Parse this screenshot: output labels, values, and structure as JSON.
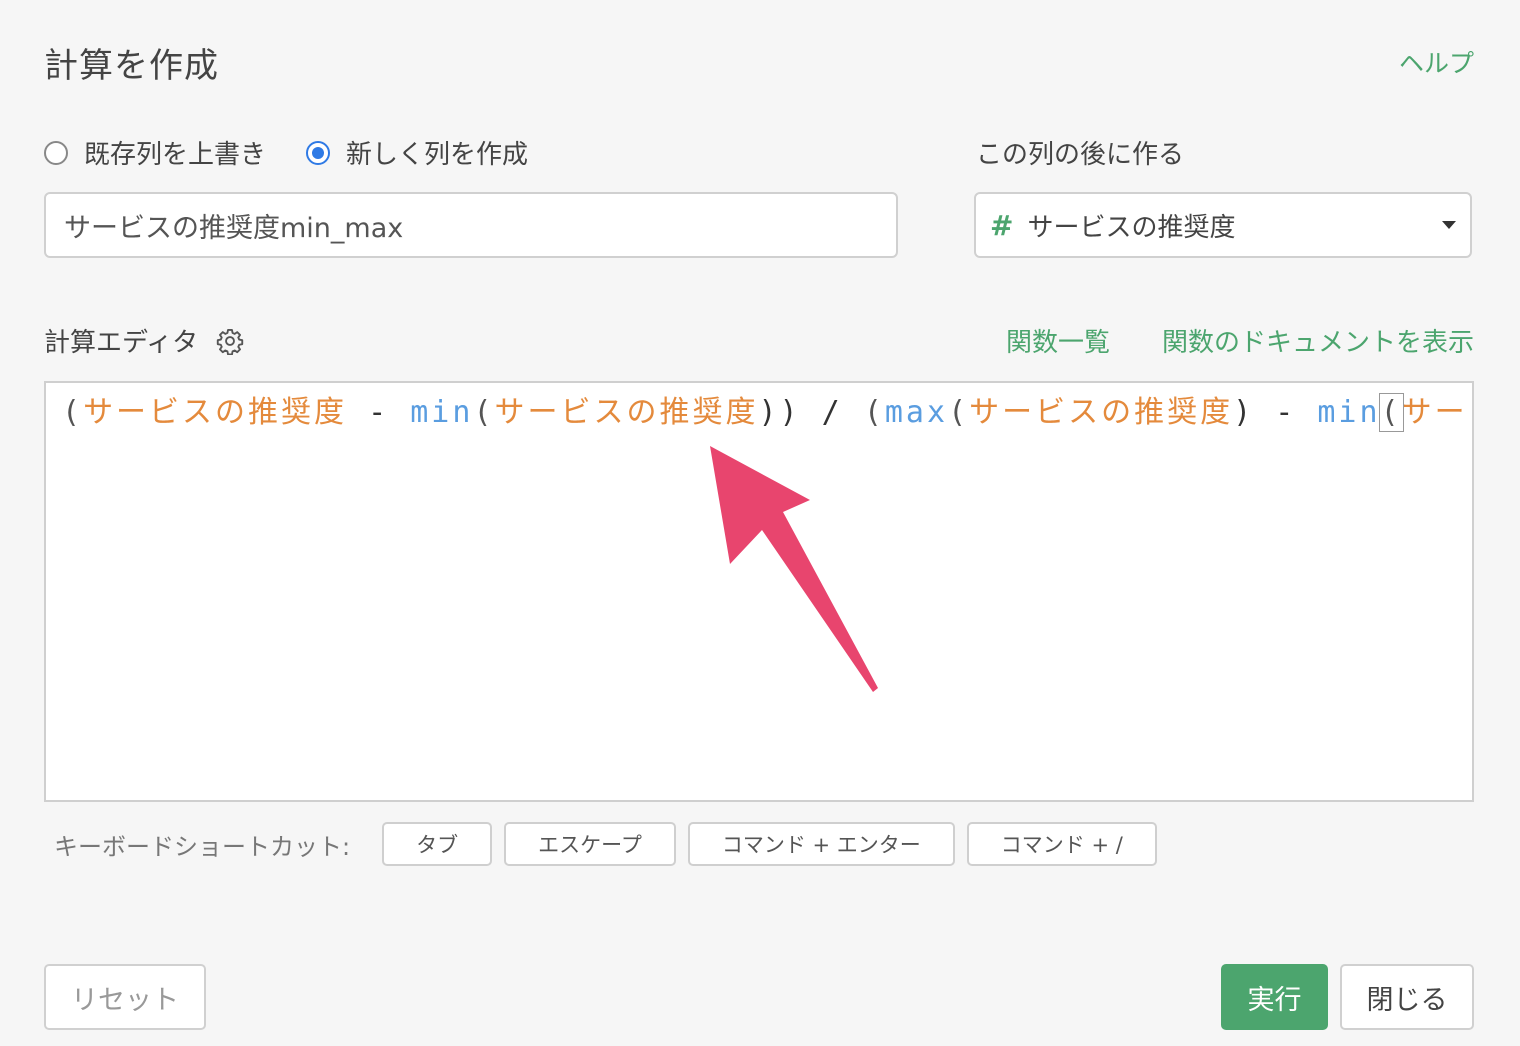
{
  "header": {
    "title": "計算を作成",
    "help": "ヘルプ"
  },
  "mode": {
    "overwrite_label": "既存列を上書き",
    "create_label": "新しく列を作成",
    "selected": "create"
  },
  "new_column": {
    "value": "サービスの推奨度min_max"
  },
  "position": {
    "label": "この列の後に作る",
    "selected_column": "サービスの推奨度",
    "column_type_icon": "hash-icon"
  },
  "editor": {
    "label": "計算エディタ",
    "functions_link": "関数一覧",
    "docs_link": "関数のドキュメントを表示",
    "tokens": [
      {
        "t": "(",
        "k": "paren"
      },
      {
        "t": "サービスの推奨度",
        "k": "col"
      },
      {
        "t": " - ",
        "k": "op"
      },
      {
        "t": "min",
        "k": "fn"
      },
      {
        "t": "(",
        "k": "paren"
      },
      {
        "t": "サービスの推奨度",
        "k": "col"
      },
      {
        "t": ")) / ",
        "k": "op"
      },
      {
        "t": "(",
        "k": "paren"
      },
      {
        "t": "max",
        "k": "fn"
      },
      {
        "t": "(",
        "k": "paren"
      },
      {
        "t": "サービスの推奨度",
        "k": "col"
      },
      {
        "t": ") - ",
        "k": "op"
      },
      {
        "t": "min",
        "k": "fn"
      },
      {
        "t": "(",
        "k": "paren-hl"
      },
      {
        "t": "サー",
        "k": "col"
      }
    ]
  },
  "shortcuts": {
    "label": "キーボードショートカット:",
    "keys": [
      "タブ",
      "エスケープ",
      "コマンド + エンター",
      "コマンド + /"
    ]
  },
  "footer": {
    "reset": "リセット",
    "run": "実行",
    "close": "閉じる"
  },
  "colors": {
    "accent_green": "#4ca56e",
    "radio_blue": "#2f7ae5",
    "column_token": "#e48a3c",
    "function_token": "#5a9de0",
    "annotation_arrow": "#e8456e"
  }
}
